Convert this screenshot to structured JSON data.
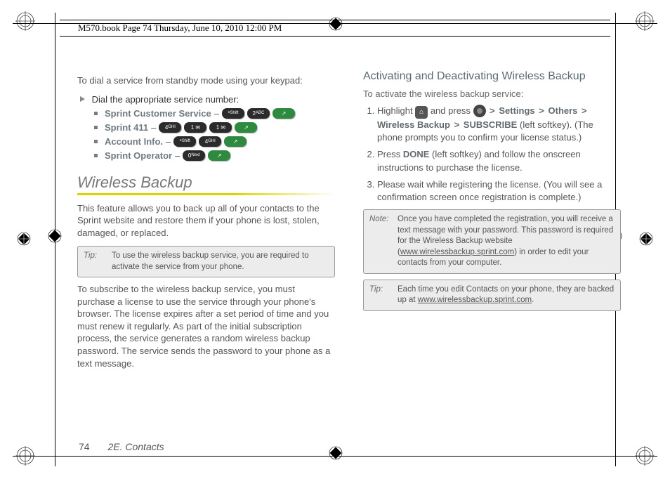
{
  "header": {
    "text": "M570.book  Page 74  Thursday, June 10, 2010  12:00 PM"
  },
  "left": {
    "intro": "To dial a service from standby mode using your keypad:",
    "dial_line": "Dial the appropriate service number:",
    "options": {
      "a": "Sprint Customer Service",
      "b": "Sprint 411",
      "c": "Account Info.",
      "d": "Sprint Operator"
    },
    "dash": "–",
    "h2": "Wireless Backup",
    "p1": "This feature allows you to back up all of your contacts to the Sprint website and restore them if your phone is lost, stolen, damaged, or replaced.",
    "tip_label": "Tip:",
    "tip_body": "To use the wireless backup service, you are required to activate the service from your phone.",
    "p2": "To subscribe to the wireless backup service, you must purchase a license to use the service through your phone's browser. The license expires after a set period of time and you must renew it regularly. As part of the initial subscription process, the service generates a random wireless backup password. The service sends the password to your phone as a text message."
  },
  "right": {
    "h3": "Activating and Deactivating Wireless Backup",
    "lead": "To activate the wireless backup service:",
    "step1_a": "Highlight ",
    "step1_b": " and press ",
    "step1_settings": "Settings",
    "step1_others": "Others",
    "step1_wb": "Wireless Backup",
    "step1_sub": "SUBSCRIBE",
    "step1_tail": " (left softkey). (The phone prompts you to confirm your license status.)",
    "step2_a": "Press ",
    "step2_done": "DONE",
    "step2_b": " (left softkey) and follow the onscreen instructions to purchase the license.",
    "step3": "Please wait while registering the license. (You will see a confirmation screen once registration is complete.)",
    "note_label": "Note:",
    "note_body_a": "Once you have completed the registration, you will receive a text message with your password. This password is required for the Wireless Backup website (",
    "note_url": "www.wirelessbackup.sprint.com",
    "note_body_b": ") in order to edit your contacts from your computer.",
    "tip_label": "Tip:",
    "tip_body_a": "Each time you edit Contacts on your phone, they are backed up at ",
    "tip_url": "www.wirelessbackup.sprint.com",
    "tip_body_b": "."
  },
  "footer": {
    "page": "74",
    "section": "2E. Contacts"
  }
}
